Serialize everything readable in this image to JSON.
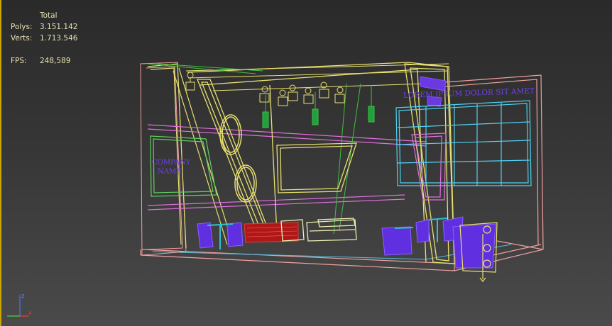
{
  "stats": {
    "header": "Total",
    "polys_label": "Polys:",
    "polys_value": "3.151.142",
    "verts_label": "Verts:",
    "verts_value": "1.713.546",
    "fps_label": "FPS:",
    "fps_value": "248,589"
  },
  "scene": {
    "company_line1": "COMPANY",
    "company_line2": "NAME",
    "banner_text": "LOREM IPSUM DOLOR SIT AMET"
  },
  "gizmo": {
    "z_label": "z",
    "x_label": "x"
  },
  "colors": {
    "stats_text": "#e6e0b0",
    "wire_yellow": "#e8e070",
    "wire_pink": "#e070e0",
    "wire_salmon": "#f0a0a0",
    "wire_cyan": "#50d0f0",
    "wire_green": "#40c040",
    "wire_purple": "#7040f0",
    "viewport_border": "#c8a800"
  }
}
